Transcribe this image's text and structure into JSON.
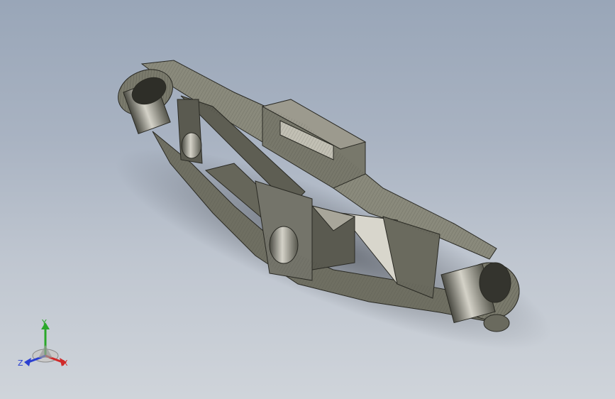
{
  "viewport": {
    "background_top": "#99a6b8",
    "background_bottom": "#cfd4da",
    "model": {
      "name": "lattice-frame-bracket",
      "shade_color": "#6f6f62",
      "edge_color": "#2a2a24"
    }
  },
  "triad": {
    "x_label": "X",
    "y_label": "Y",
    "z_label": "Z",
    "x_color": "#d02a2a",
    "y_color": "#2aa82a",
    "z_color": "#2a3fd0"
  }
}
